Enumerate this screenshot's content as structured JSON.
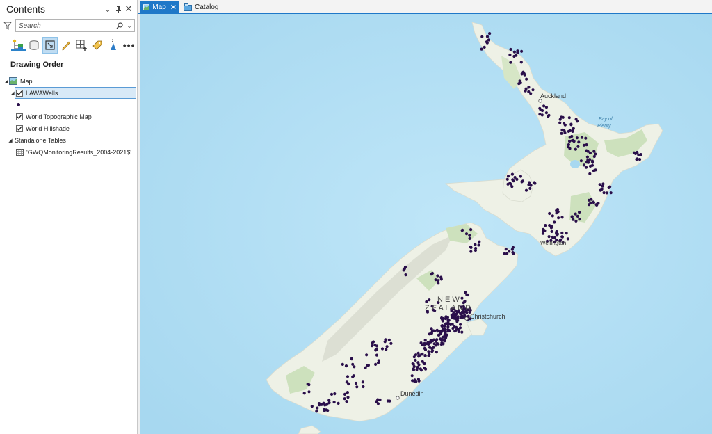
{
  "contents": {
    "title": "Contents",
    "search_placeholder": "Search",
    "section": "Drawing Order",
    "map_name": "Map",
    "layers": [
      {
        "name": "LAWAWells",
        "checked": true,
        "selected": true
      },
      {
        "name": "World Topographic Map",
        "checked": true
      },
      {
        "name": "World Hillshade",
        "checked": true
      }
    ],
    "standalone_header": "Standalone Tables",
    "table_name": "'GWQMonitoringResults_2004-2021$'",
    "toolbar_icons": [
      "list-by-drawing-order-icon",
      "list-by-source-icon",
      "list-by-selection-icon",
      "list-by-editing-icon",
      "list-by-snapping-icon",
      "list-by-labeling-icon",
      "list-by-perspective-icon",
      "more-icon"
    ]
  },
  "tabs": [
    {
      "label": "Map",
      "active": true
    },
    {
      "label": "Catalog",
      "active": false
    }
  ],
  "map": {
    "labels": {
      "auckland": "Auckland",
      "bay": "Bay of",
      "plenty": "Plenty",
      "new": "N E W",
      "zealand": "Z E A L A N D",
      "christchurch": "Christchurch",
      "dunedin": "Dunedin",
      "wellington": "Wellington"
    },
    "colors": {
      "ocean": "#b4dff4",
      "land": "#eef1e6",
      "forest": "#cde1bd",
      "well_point": "#2a0f4a"
    }
  }
}
